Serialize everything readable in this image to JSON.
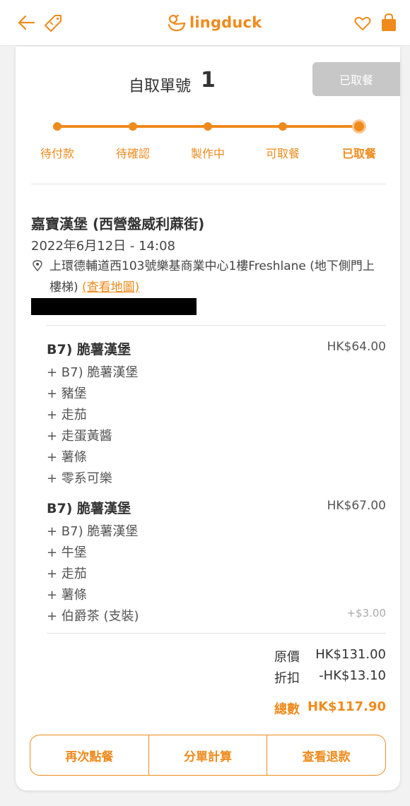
{
  "header": {
    "brand": "lingduck"
  },
  "order": {
    "pickup_label": "自取單號",
    "pickup_number": "1",
    "status": "已取餐",
    "progress_steps": [
      "待付款",
      "待確認",
      "製作中",
      "可取餐",
      "已取餐"
    ],
    "current_step": 4
  },
  "shop": {
    "name": "嘉寶漢堡 (西營盤威利蔴街)",
    "datetime": "2022年6月12日 - 14:08",
    "address": "上環德輔道西103號樂基商業中心1樓Freshlane (地下側門上樓梯)",
    "map_link": "(查看地圖)"
  },
  "items": [
    {
      "name": "B7) 脆薯漢堡",
      "price": "HK$64.00",
      "options": [
        {
          "label": "+ B7) 脆薯漢堡",
          "price": ""
        },
        {
          "label": "+ 豬堡",
          "price": ""
        },
        {
          "label": "+ 走茄",
          "price": ""
        },
        {
          "label": "+ 走蛋黃醬",
          "price": ""
        },
        {
          "label": "+ 薯條",
          "price": ""
        },
        {
          "label": "+ 零系可樂",
          "price": ""
        }
      ]
    },
    {
      "name": "B7) 脆薯漢堡",
      "price": "HK$67.00",
      "options": [
        {
          "label": "+ B7) 脆薯漢堡",
          "price": ""
        },
        {
          "label": "+ 牛堡",
          "price": ""
        },
        {
          "label": "+ 走茄",
          "price": ""
        },
        {
          "label": "+ 薯條",
          "price": ""
        },
        {
          "label": "+ 伯爵茶 (支裝)",
          "price": "+$3.00"
        }
      ]
    }
  ],
  "summary": {
    "original_label": "原價",
    "original_value": "HK$131.00",
    "discount_label": "折扣",
    "discount_value": "-HK$13.10",
    "total_label": "總數",
    "total_value": "HK$117.90"
  },
  "actions": [
    "再次點餐",
    "分單計算",
    "查看退款"
  ],
  "colors": {
    "accent": "#ef8b1d",
    "badge_bg": "#c7c7c7"
  }
}
